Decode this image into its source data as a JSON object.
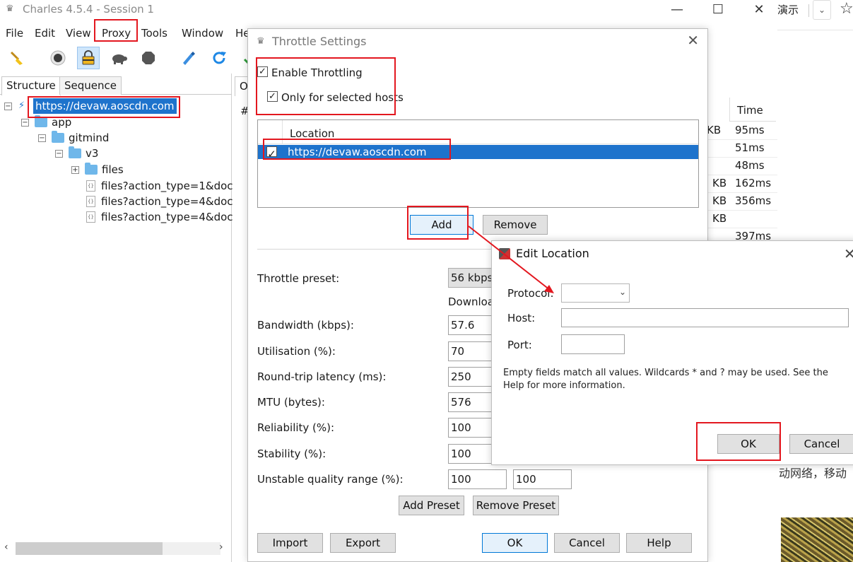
{
  "window": {
    "title": "Charles 4.5.4 - Session 1",
    "controls": {
      "minimize": "—",
      "maximize": "☐",
      "close": "✕"
    }
  },
  "menu": [
    "File",
    "Edit",
    "View",
    "Proxy",
    "Tools",
    "Window",
    "He"
  ],
  "toolbar_icons": [
    "broom-icon",
    "record-icon",
    "ssl-proxying-icon",
    "throttle-turtle-icon",
    "stop-icon",
    "pen-icon",
    "refresh-icon",
    "check-icon"
  ],
  "left_panel": {
    "tabs": [
      "Structure",
      "Sequence"
    ],
    "tree": {
      "host": "https://devaw.aoscdn.com",
      "nodes": [
        "app",
        "gitmind",
        "v3",
        "files"
      ],
      "files": [
        "files?action_type=1&doc",
        "files?action_type=4&doc",
        "files?action_type=4&doc"
      ]
    }
  },
  "right_area": {
    "tab_stub": "O",
    "hash": "#",
    "time_header": "Time",
    "rows": [
      {
        "size": "KB",
        "time": "95ms"
      },
      {
        "size": "",
        "time": "51ms"
      },
      {
        "size": "",
        "time": "48ms"
      },
      {
        "size": "KB",
        "time": "162ms"
      },
      {
        "size": "KB",
        "time": "356ms"
      },
      {
        "size": "KB",
        "time": ""
      },
      {
        "size": "",
        "time": "397ms"
      }
    ]
  },
  "throttle_dialog": {
    "title": "Throttle Settings",
    "enable_throttling": "Enable Throttling",
    "only_selected_hosts": "Only for selected hosts",
    "location_header": "Location",
    "location_value": "https://devaw.aoscdn.com",
    "add_button": "Add",
    "remove_button": "Remove",
    "throttle_preset_label": "Throttle preset:",
    "throttle_preset_value": "56 kbps",
    "download_header": "Downloa",
    "settings": [
      {
        "label": "Bandwidth (kbps):",
        "value": "57.6"
      },
      {
        "label": "Utilisation (%):",
        "value": "70"
      },
      {
        "label": "Round-trip latency (ms):",
        "value": "250"
      },
      {
        "label": "MTU (bytes):",
        "value": "576"
      },
      {
        "label": "Reliability (%):",
        "value": "100"
      },
      {
        "label": "Stability (%):",
        "value": "100"
      },
      {
        "label": "Unstable quality range (%):",
        "value": "100",
        "value2": "100"
      }
    ],
    "add_preset": "Add Preset",
    "remove_preset": "Remove Preset",
    "import": "Import",
    "export": "Export",
    "ok": "OK",
    "cancel": "Cancel",
    "help": "Help"
  },
  "edit_location_dialog": {
    "title": "Edit Location",
    "protocol_label": "Protocol:",
    "host_label": "Host:",
    "port_label": "Port:",
    "protocol_value": "",
    "host_value": "",
    "port_value": "",
    "hint": "Empty fields match all values. Wildcards * and ? may be used. See the Help for more information.",
    "ok": "OK",
    "cancel": "Cancel"
  },
  "browser_bg": {
    "tab_text": "演示",
    "body_text": "动网络，移动"
  },
  "colors": {
    "selection_blue": "#1e73cc",
    "annotation_red": "#e3171f",
    "folder_blue": "#6fb7ea"
  }
}
